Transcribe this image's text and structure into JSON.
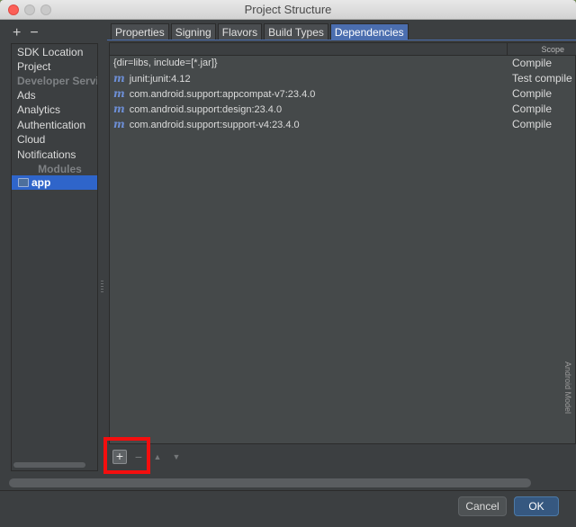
{
  "window": {
    "title": "Project Structure"
  },
  "sidebar": {
    "add_glyph": "+",
    "remove_glyph": "−",
    "items": [
      {
        "label": "SDK Location",
        "kind": "item"
      },
      {
        "label": "Project",
        "kind": "item"
      },
      {
        "label": "Developer Servic",
        "kind": "header"
      },
      {
        "label": "Ads",
        "kind": "item"
      },
      {
        "label": "Analytics",
        "kind": "item"
      },
      {
        "label": "Authentication",
        "kind": "item"
      },
      {
        "label": "Cloud",
        "kind": "item"
      },
      {
        "label": "Notifications",
        "kind": "item"
      },
      {
        "label": "Modules",
        "kind": "section"
      },
      {
        "label": "app",
        "kind": "selected",
        "icon": "module-folder-icon"
      }
    ]
  },
  "tabs": [
    {
      "label": "Properties",
      "active": false
    },
    {
      "label": "Signing",
      "active": false
    },
    {
      "label": "Flavors",
      "active": false
    },
    {
      "label": "Build Types",
      "active": false
    },
    {
      "label": "Dependencies",
      "active": true
    }
  ],
  "dependencies": {
    "scope_header": "Scope",
    "rows": [
      {
        "icon": "",
        "name": "{dir=libs, include=[*.jar]}",
        "scope": "Compile"
      },
      {
        "icon": "m",
        "name": "junit:junit:4.12",
        "scope": "Test compile"
      },
      {
        "icon": "m",
        "name": "com.android.support:appcompat-v7:23.4.0",
        "scope": "Compile"
      },
      {
        "icon": "m",
        "name": "com.android.support:design:23.4.0",
        "scope": "Compile"
      },
      {
        "icon": "m",
        "name": "com.android.support:support-v4:23.4.0",
        "scope": "Compile"
      }
    ]
  },
  "toolbar": {
    "add_glyph": "+",
    "remove_glyph": "−",
    "up_glyph": "▲",
    "down_glyph": "▼"
  },
  "buttons": {
    "cancel": "Cancel",
    "ok": "OK"
  },
  "side_panel_label": "Android Model",
  "colors": {
    "accent": "#4b6eaf",
    "selection": "#2f65ca",
    "highlight": "#f40e0e",
    "maven_icon": "#6d8fd6"
  }
}
